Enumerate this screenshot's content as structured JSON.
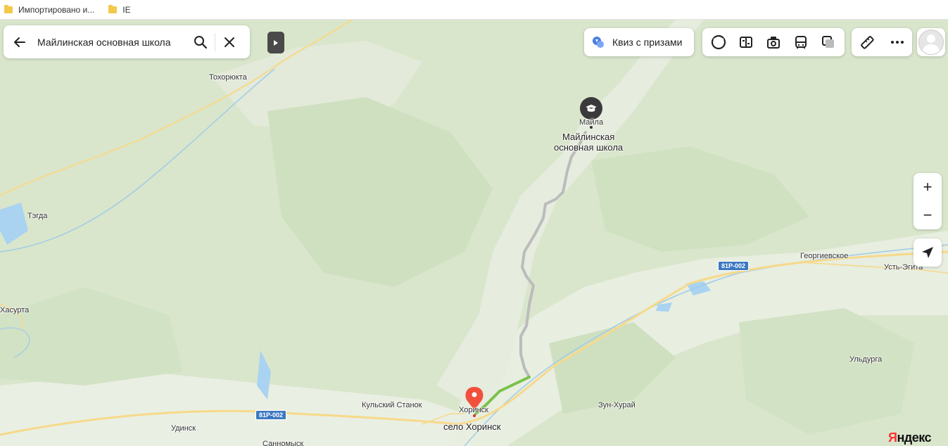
{
  "bookmarks": [
    "Импортировано и...",
    "IE"
  ],
  "search": {
    "value": "Майлинская основная школа"
  },
  "quiz": {
    "label": "Квиз с призами"
  },
  "places": {
    "tokhoryukta": "Тохорюкта",
    "tegda": "Тэгда",
    "khasurta": "Хасурта",
    "maila": "Майла",
    "school_line1": "Майлинская",
    "school_line2": "основная школа",
    "georgievskoe": "Георгиевское",
    "ust_egita": "Усть-Эгита",
    "uldurga": "Ульдурга",
    "zun_khurai": "Зун-Хурай",
    "kulsky_stanok": "Кульский Станок",
    "khorinsk": "Хоринск",
    "selo_khorinsk": "село Хоринск",
    "udinsk": "Удинск",
    "sannomysk": "Санномыск"
  },
  "roads": {
    "r1": "81Р-002",
    "r2": "81Р-002"
  },
  "zoom": {
    "plus": "+",
    "minus": "−"
  },
  "logo": {
    "first": "Я",
    "rest": "ндекс"
  },
  "colors": {
    "route_main": "#bcbcbc",
    "route_active": "#7ac14a",
    "pin": "#f2503c",
    "road": "#f7d98a"
  }
}
